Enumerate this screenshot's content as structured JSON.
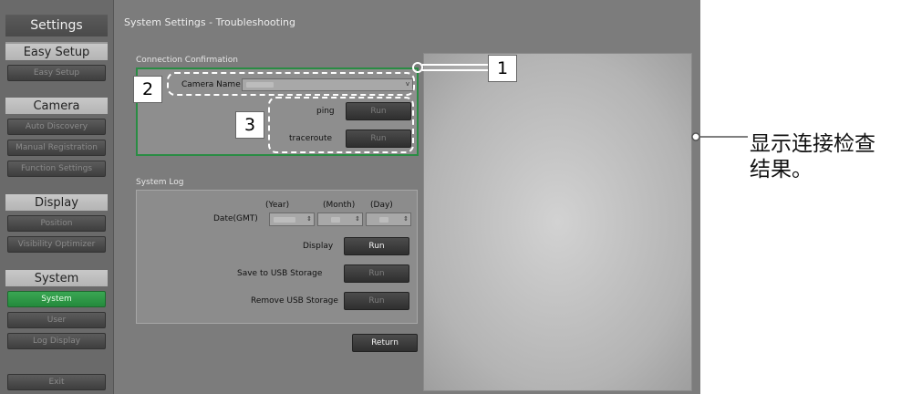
{
  "sidebar": {
    "title": "Settings",
    "sections": [
      {
        "label": "Easy Setup",
        "items": [
          "Easy Setup"
        ]
      },
      {
        "label": "Camera",
        "items": [
          "Auto Discovery",
          "Manual Registration",
          "Function Settings"
        ]
      },
      {
        "label": "Display",
        "items": [
          "Position",
          "Visibility Optimizer"
        ]
      },
      {
        "label": "System",
        "items": [
          "System",
          "User",
          "Log Display"
        ]
      }
    ],
    "exit_label": "Exit"
  },
  "page_title": "System Settings - Troubleshooting",
  "connection": {
    "group_label": "Connection Confirmation",
    "camera_name_label": "Camera Name",
    "ping_label": "ping",
    "traceroute_label": "traceroute",
    "run_label": "Run"
  },
  "log": {
    "group_label": "System Log",
    "year_label": "(Year)",
    "month_label": "(Month)",
    "day_label": "(Day)",
    "date_label": "Date(GMT)",
    "display_label": "Display",
    "save_label": "Save to USB Storage",
    "remove_label": "Remove USB Storage",
    "run_label": "Run"
  },
  "return_label": "Return",
  "callouts": {
    "one": "1",
    "two": "2",
    "three": "3"
  },
  "annotation": {
    "line1": "显示连接检查",
    "line2": "结果。"
  },
  "colors": {
    "active": "#2f9a48",
    "frame": "#2a8c44"
  }
}
